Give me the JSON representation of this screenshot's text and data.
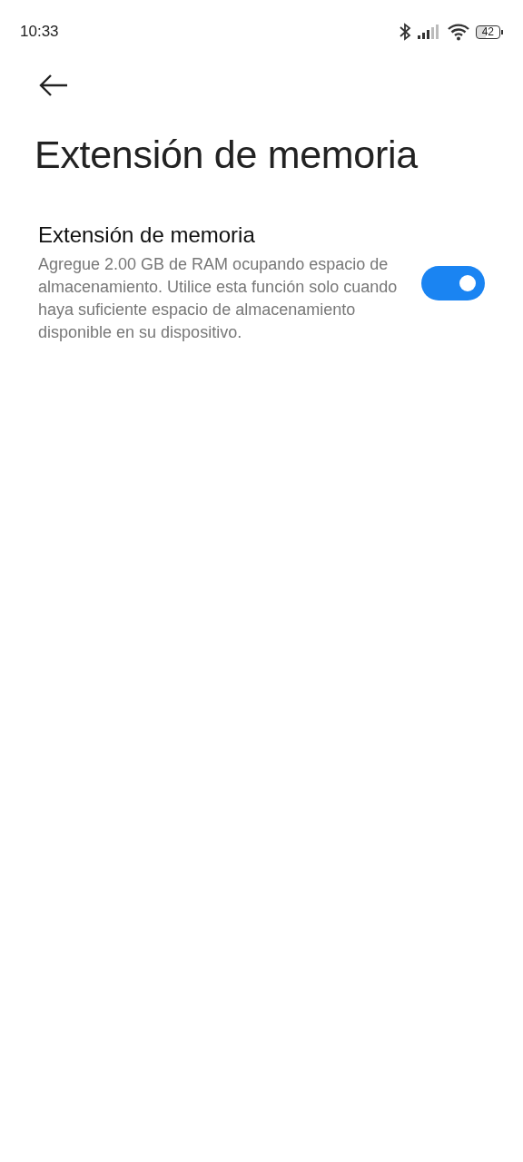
{
  "status_bar": {
    "time": "10:33",
    "battery": "42"
  },
  "page": {
    "title": "Extensión de memoria"
  },
  "setting": {
    "title": "Extensión de memoria",
    "description": "Agregue 2.00 GB de RAM ocupando espacio de almacenamiento. Utilice esta función solo cuando haya suficiente espacio de almacenamiento disponible en su dispositivo.",
    "on": true
  }
}
